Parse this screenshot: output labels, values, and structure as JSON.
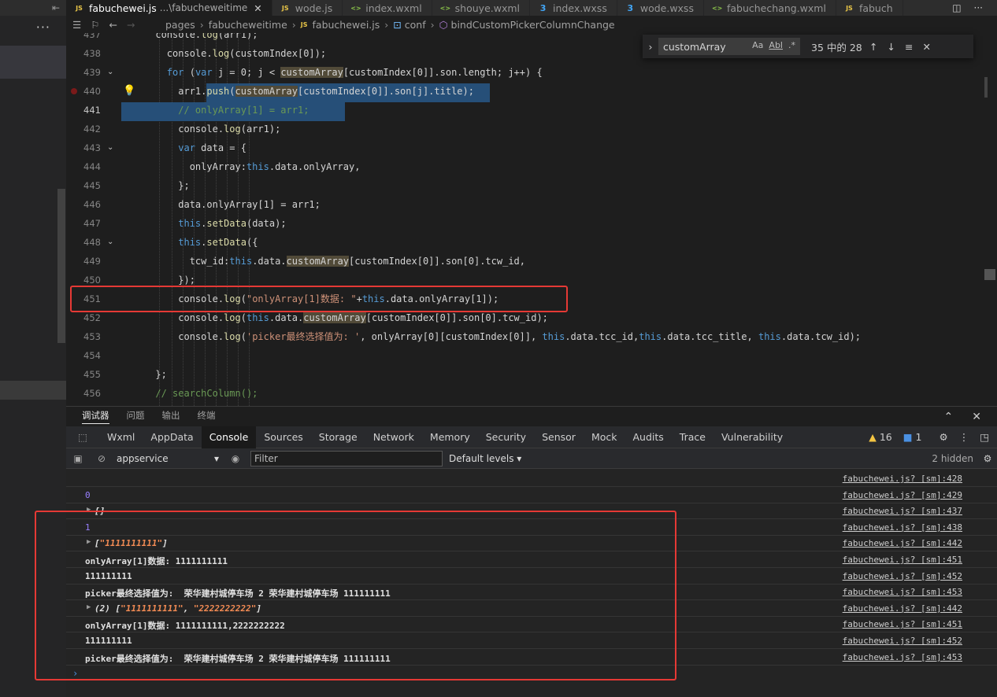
{
  "left": {
    "menu_dots": "···",
    "collapse_icon": "⇤"
  },
  "tabs": [
    {
      "icon": "JS",
      "kind": "js",
      "name": "fabuchewei.js",
      "dir": "...\\fabucheweitime",
      "active": true
    },
    {
      "icon": "JS",
      "kind": "js",
      "name": "wode.js"
    },
    {
      "icon": "<>",
      "kind": "wx",
      "name": "index.wxml"
    },
    {
      "icon": "<>",
      "kind": "wx",
      "name": "shouye.wxml"
    },
    {
      "icon": "3",
      "kind": "css",
      "name": "index.wxss"
    },
    {
      "icon": "3",
      "kind": "css",
      "name": "wode.wxss"
    },
    {
      "icon": "<>",
      "kind": "wx",
      "name": "fabuchechang.wxml"
    },
    {
      "icon": "JS",
      "kind": "js",
      "name": "fabuch"
    }
  ],
  "breadcrumb": {
    "items": [
      "pages",
      "fabucheweitime",
      "fabuchewei.js",
      "conf",
      "bindCustomPickerColumnChange"
    ]
  },
  "find": {
    "query": "customArray",
    "opt_case": "Aa",
    "opt_word": "Abl",
    "opt_regex": ".*",
    "count": "35 中的 28"
  },
  "editor": {
    "lines": [
      {
        "n": "437",
        "code": "      console.log(arr1);"
      },
      {
        "n": "438",
        "code": "        console.log(customIndex[0]);"
      },
      {
        "n": "439",
        "code": "        for (var j = 0; j < customArray[customIndex[0]].son.length; j++) {"
      },
      {
        "n": "440",
        "code": "          arr1.push(customArray[customIndex[0]].son[j].title);"
      },
      {
        "n": "441",
        "code": "          // onlyArray[1] = arr1;"
      },
      {
        "n": "442",
        "code": "          console.log(arr1);"
      },
      {
        "n": "443",
        "code": "          var data = {"
      },
      {
        "n": "444",
        "code": "            onlyArray:this.data.onlyArray,"
      },
      {
        "n": "445",
        "code": "          };"
      },
      {
        "n": "446",
        "code": "          data.onlyArray[1] = arr1;"
      },
      {
        "n": "447",
        "code": "          this.setData(data);"
      },
      {
        "n": "448",
        "code": "          this.setData({"
      },
      {
        "n": "449",
        "code": "            tcw_id:this.data.customArray[customIndex[0]].son[0].tcw_id,"
      },
      {
        "n": "450",
        "code": "          });"
      },
      {
        "n": "451",
        "code": "          console.log(\"onlyArray[1]数据: \"+this.data.onlyArray[1]);"
      },
      {
        "n": "452",
        "code": "          console.log(this.data.customArray[customIndex[0]].son[0].tcw_id);"
      },
      {
        "n": "453",
        "code": "          console.log('picker最终选择值为: ', onlyArray[0][customIndex[0]], this.data.tcc_id,this.data.tcc_title, this.data.tcw_id);"
      },
      {
        "n": "454",
        "code": ""
      },
      {
        "n": "455",
        "code": "      };"
      },
      {
        "n": "456",
        "code": "      // searchColumn();"
      }
    ]
  },
  "panel_tabs": [
    "调试器",
    "问题",
    "输出",
    "终端"
  ],
  "devtools_tabs": [
    "Wxml",
    "AppData",
    "Console",
    "Sources",
    "Storage",
    "Network",
    "Memory",
    "Security",
    "Sensor",
    "Mock",
    "Audits",
    "Trace",
    "Vulnerability"
  ],
  "devtools_status": {
    "warnings": "16",
    "infos": "1"
  },
  "toolbar": {
    "context": "appservice",
    "filter_placeholder": "Filter",
    "levels": "Default levels",
    "hidden": "2 hidden"
  },
  "console": {
    "rows": [
      {
        "msg": "",
        "src": "fabuchewei.js? [sm]:428"
      },
      {
        "msg": "0",
        "num": true,
        "src": "fabuchewei.js? [sm]:429"
      },
      {
        "msg": "[]",
        "arrow": true,
        "src": "fabuchewei.js? [sm]:437"
      },
      {
        "msg": "1",
        "num": true,
        "src": "fabuchewei.js? [sm]:438"
      },
      {
        "msg": "[\"1111111111\"]",
        "arrow": true,
        "src": "fabuchewei.js? [sm]:442"
      },
      {
        "msg": "onlyArray[1]数据: 1111111111",
        "src": "fabuchewei.js? [sm]:451"
      },
      {
        "msg": "111111111",
        "src": "fabuchewei.js? [sm]:452"
      },
      {
        "msg": "picker最终选择值为:  荣华建村城停车场 2 荣华建村城停车场 111111111",
        "src": "fabuchewei.js? [sm]:453"
      },
      {
        "msg": "(2) [\"1111111111\", \"2222222222\"]",
        "arrow": true,
        "src": "fabuchewei.js? [sm]:442"
      },
      {
        "msg": "onlyArray[1]数据: 1111111111,2222222222",
        "src": "fabuchewei.js? [sm]:451"
      },
      {
        "msg": "111111111",
        "src": "fabuchewei.js? [sm]:452"
      },
      {
        "msg": "picker最终选择值为:  荣华建村城停车场 2 荣华建村城停车场 111111111",
        "src": "fabuchewei.js? [sm]:453"
      }
    ],
    "prompt": "›"
  }
}
